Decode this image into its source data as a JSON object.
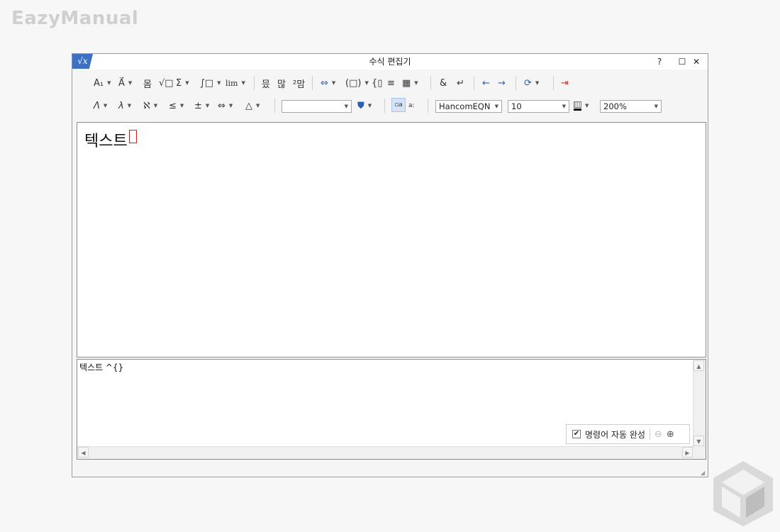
{
  "brand": "EazyManual",
  "window": {
    "title": "수식 편집기",
    "icon_label": "√x",
    "help": "?",
    "maximize": "☐",
    "close": "✕"
  },
  "toolbar1": {
    "subscript": "A₁",
    "decoration": "A⃗",
    "fraction": "몸",
    "root": "√□",
    "sum": "Σ",
    "integral": "∫□",
    "limit": "lim",
    "matrix1": "믔",
    "matrix2": "많",
    "matrix3": "²맘",
    "arrows": "⇔",
    "bracket": "(□)",
    "cases": "{▯",
    "align": "≡",
    "grid": "▦",
    "ampersand": "&",
    "newline": "↵",
    "prev": "←",
    "next": "→",
    "refresh": "⟳",
    "exit": "⇥"
  },
  "toolbar2": {
    "greek_upper": "Λ",
    "greek_lower": "λ",
    "hebrew": "ℵ",
    "relation": "≤",
    "operator": "±",
    "arrow": "⇔",
    "misc": "△",
    "font_name": "HancomEQN",
    "font_size": "10",
    "zoom": "200%"
  },
  "editor": {
    "formula_text": "텍스트"
  },
  "script": {
    "text": "텍스트 ^{}"
  },
  "autocomplete": {
    "label": "명령어 자동 완성",
    "checked": true
  }
}
